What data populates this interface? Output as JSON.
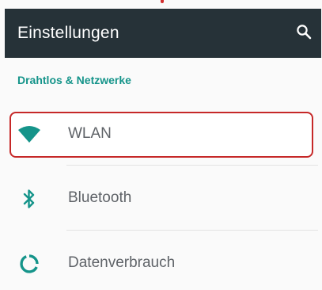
{
  "toolbar": {
    "title": "Einstellungen",
    "search_icon": "search-icon"
  },
  "section": {
    "header": "Drahtlos & Netzwerke"
  },
  "items": [
    {
      "label": "WLAN",
      "icon": "wifi-icon",
      "highlighted": true
    },
    {
      "label": "Bluetooth",
      "icon": "bluetooth-icon"
    },
    {
      "label": "Datenverbrauch",
      "icon": "data-usage-icon"
    }
  ],
  "colors": {
    "toolbar_bg": "#263238",
    "accent": "#15948a",
    "highlight_border": "#c62828",
    "label_text": "#5f6368"
  }
}
